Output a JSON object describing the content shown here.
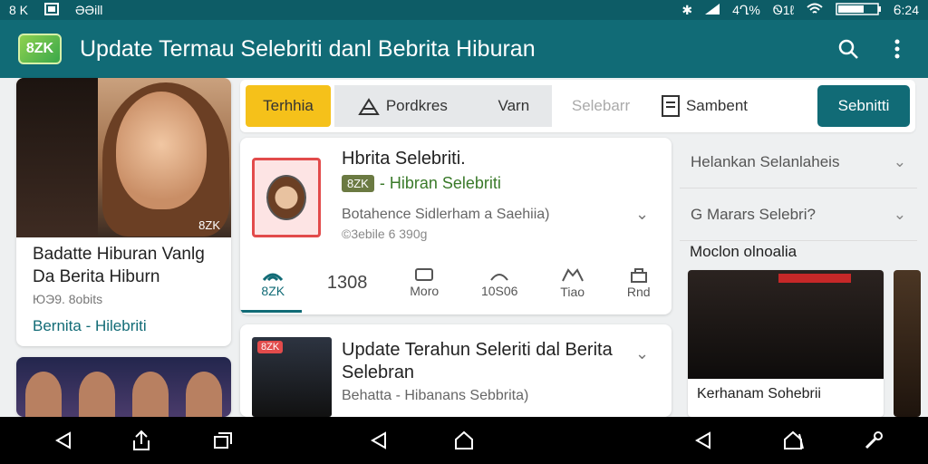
{
  "status_bar": {
    "left_text": "8 K",
    "left_app": "ƏƏill",
    "battery": "4Ղ%",
    "misc": "Ꮻ1ℓ",
    "time": "Ꮾ:24"
  },
  "app_bar": {
    "logo": "8ZK",
    "title": "Update Termau Selebriti danl Bebrita Hiburan"
  },
  "tabs": [
    {
      "label": "Terhhia"
    },
    {
      "label": "Pordkres"
    },
    {
      "label": "Varn"
    },
    {
      "label": "Selebarr"
    },
    {
      "label": "Sambent"
    },
    {
      "label": "Sebnitti"
    }
  ],
  "left_card": {
    "headline": "Badatte Hiburan Vanlg Da Berita Hiburn",
    "meta": "ЮЭ9. 8obits",
    "source": "Bernita - Hilebriti",
    "photo_tag": "8ZK"
  },
  "main_card_1": {
    "title": "Hbrita Selebriti.",
    "badge": "8ZK",
    "source": "- Hibran Selebriti",
    "desc": "Botahence Sidlerham a Saehiia)",
    "meta": "©3ebile 6 390g",
    "stats": [
      {
        "label": "8ZK",
        "icon": "signal-icon"
      },
      {
        "label": "1308"
      },
      {
        "label": "Moro",
        "icon": "box-icon"
      },
      {
        "label": "10S06",
        "icon": "arc-icon"
      },
      {
        "label": "Tiao",
        "icon": "hands-icon"
      },
      {
        "label": "Rnd",
        "icon": "lock-icon"
      }
    ]
  },
  "main_card_2": {
    "chip": "8ZK",
    "title": "Update Terahun Seleriti dal Berita Selebran",
    "source": "Behatta - Hibanans Sebbrita)"
  },
  "side_panel": {
    "rows": [
      {
        "label": "Helankan Selanlaheis"
      },
      {
        "label": "G Marars Selebri?"
      }
    ],
    "heading": "Moclon olnoalia",
    "caption": "Kerhanam Sohebrii"
  },
  "colors": {
    "primary": "#116b76",
    "accent": "#f5c11a",
    "status": "#0d5c66"
  }
}
